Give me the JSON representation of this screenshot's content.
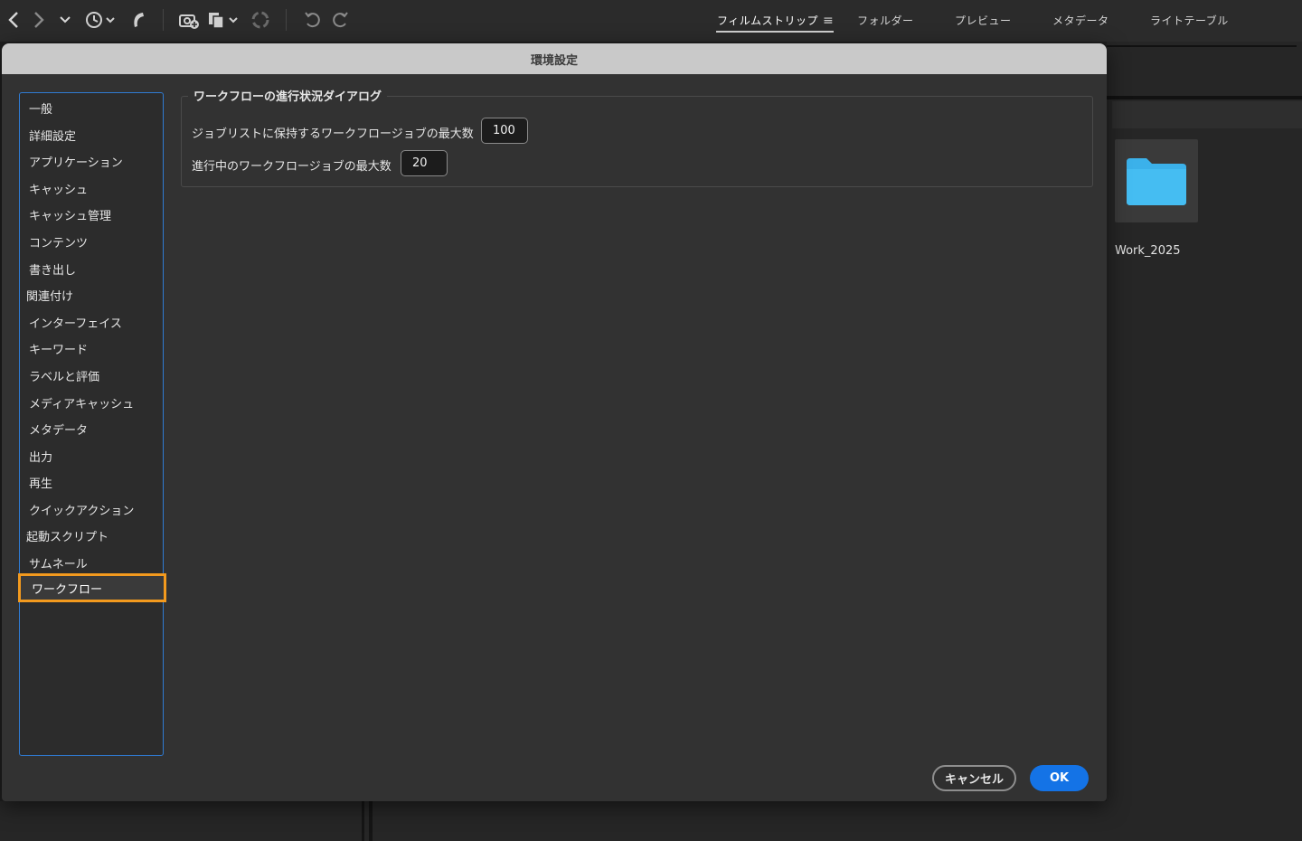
{
  "toolbar": {
    "icons": [
      "back-arrow-icon",
      "forward-arrow-icon",
      "chevron-down-icon",
      "history-icon",
      "boomerang-icon",
      "camera-download-icon",
      "copy-stack-icon",
      "refine-icon",
      "undo-icon",
      "redo-icon"
    ]
  },
  "workspaces": {
    "active": "フィルムストリップ",
    "tabs": [
      "フィルムストリップ",
      "フォルダー",
      "プレビュー",
      "メタデータ",
      "ライトテーブル"
    ]
  },
  "content": {
    "folder_name": "Work_2025"
  },
  "dialog": {
    "title": "環境設定",
    "categories": [
      "一般",
      "詳細設定",
      "アプリケーション",
      "キャッシュ",
      "キャッシュ管理",
      "コンテンツ",
      "書き出し",
      "関連付け",
      "インターフェイス",
      "キーワード",
      "ラベルと評価",
      "メディアキャッシュ",
      "メタデータ",
      "出力",
      "再生",
      "クイックアクション",
      "起動スクリプト",
      "サムネール",
      "ワークフロー"
    ],
    "selected_category": "ワークフロー",
    "group_title": "ワークフローの進行状況ダイアログ",
    "fields": [
      {
        "label": "ジョブリストに保持するワークフロージョブの最大数",
        "value": "100"
      },
      {
        "label": "進行中のワークフロージョブの最大数",
        "value": "20"
      }
    ],
    "cancel_label": "キャンセル",
    "ok_label": "OK"
  },
  "colors": {
    "accent": "#1473e6",
    "selection_highlight": "#f39a1e",
    "list_border": "#2f7bd3",
    "folder": "#3bb1ea"
  }
}
